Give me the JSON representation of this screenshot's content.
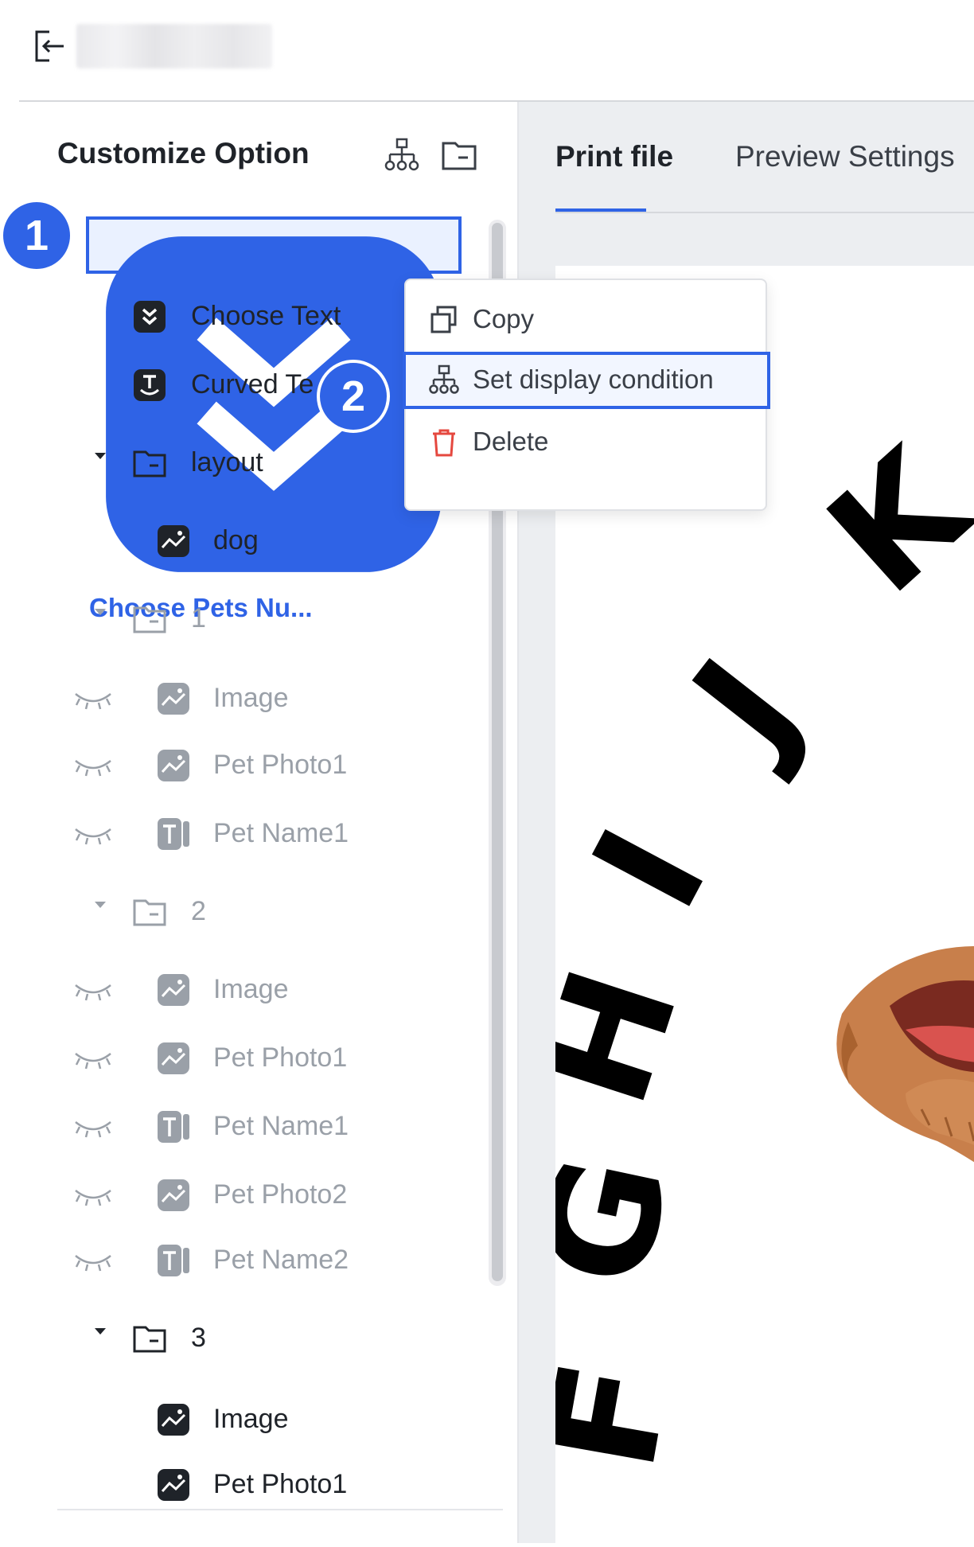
{
  "header": {
    "back_icon": "logout-arrow-icon"
  },
  "left_panel": {
    "title": "Customize Option",
    "header_icons": [
      "hierarchy-icon",
      "folder-icon"
    ],
    "selected_item": "Choose Pets Nu...",
    "items": [
      {
        "label": "Choose Pets Nu...",
        "icon": "dropdown-icon"
      },
      {
        "label": "Choose Text",
        "icon": "dropdown-icon"
      },
      {
        "label": "Curved Te",
        "icon": "curved-text-icon"
      },
      {
        "label": "layout",
        "icon": "folder-icon"
      },
      {
        "label": "dog",
        "icon": "image-icon"
      },
      {
        "label": "1",
        "icon": "folder-icon"
      },
      {
        "label": "Image",
        "icon": "image-icon"
      },
      {
        "label": "Pet Photo1",
        "icon": "image-icon"
      },
      {
        "label": "Pet Name1",
        "icon": "text-icon"
      },
      {
        "label": "2",
        "icon": "folder-icon"
      },
      {
        "label": "Image",
        "icon": "image-icon"
      },
      {
        "label": "Pet Photo1",
        "icon": "image-icon"
      },
      {
        "label": "Pet Name1",
        "icon": "text-icon"
      },
      {
        "label": "Pet Photo2",
        "icon": "image-icon"
      },
      {
        "label": "Pet Name2",
        "icon": "text-icon"
      },
      {
        "label": "3",
        "icon": "folder-icon"
      },
      {
        "label": "Image",
        "icon": "image-icon"
      },
      {
        "label": "Pet Photo1",
        "icon": "image-icon"
      }
    ]
  },
  "tabs": [
    {
      "label": "Print file",
      "active": true
    },
    {
      "label": "Preview Settings",
      "active": false
    }
  ],
  "context_menu": {
    "items": [
      {
        "label": "Copy",
        "icon": "copy-icon"
      },
      {
        "label": "Set display condition",
        "icon": "hierarchy-icon"
      },
      {
        "label": "Delete",
        "icon": "trash-icon"
      }
    ],
    "highlighted": "Set display condition"
  },
  "annotations": {
    "step1": "1",
    "step2": "2"
  },
  "canvas_letters": [
    "F",
    "G",
    "H",
    "I",
    "J",
    "K"
  ],
  "colors": {
    "accent": "#2f63e6",
    "delete": "#e5483f",
    "dim_text": "#9aa0a8",
    "canvas_bg": "#eceef1"
  }
}
